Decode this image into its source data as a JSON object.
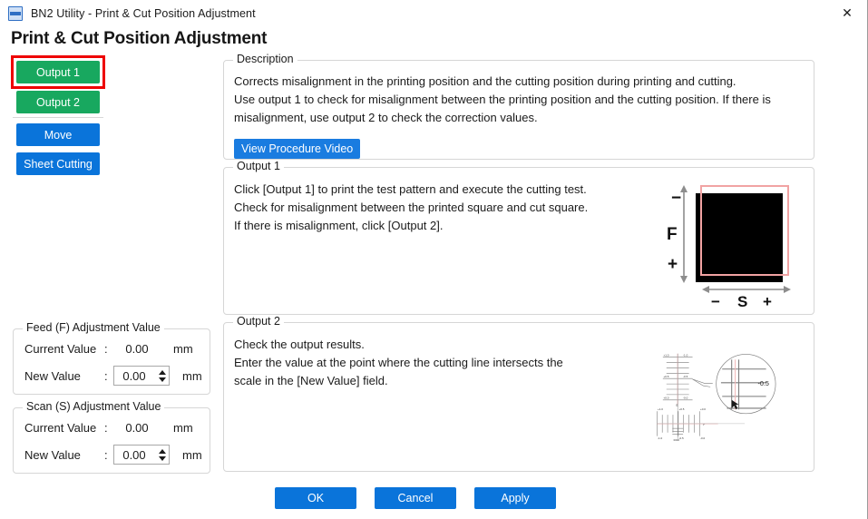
{
  "window": {
    "title": "BN2 Utility - Print & Cut Position Adjustment",
    "icon": "bn2-app-icon",
    "close_label": "✕"
  },
  "page_title": "Print & Cut Position Adjustment",
  "sidebar": {
    "buttons": [
      {
        "label": "Output 1",
        "color": "#18a85f",
        "focused": true
      },
      {
        "label": "Output 2",
        "color": "#18a85f",
        "focused": false
      },
      {
        "label": "Move",
        "color": "#0a74da",
        "focused": false
      },
      {
        "label": "Sheet Cutting",
        "color": "#0a74da",
        "focused": false
      }
    ]
  },
  "description": {
    "legend": "Description",
    "text": "Corrects misalignment in the printing position and the cutting position during printing and cutting.\nUse output 1 to check for misalignment between the printing position and the cutting position. If there is misalignment, use output 2 to check the correction values.",
    "video_button": "View Procedure Video"
  },
  "output1": {
    "legend": "Output 1",
    "text": "Click [Output 1] to print the test pattern and execute the cutting test.\nCheck for misalignment between the printed square and cut square.\nIf there is misalignment, click [Output 2].",
    "figure": {
      "feed_axis_label": "F",
      "feed_minus": "−",
      "feed_plus": "+",
      "scan_axis_label": "S",
      "scan_minus": "−",
      "scan_plus": "+",
      "printed_square_color": "#000000",
      "cut_square_color": "#f1a3a3"
    }
  },
  "output2": {
    "legend": "Output 2",
    "text": "Check the output results.\nEnter the value at the point where the cutting line intersects the\nscale in the [New Value] field.",
    "figure": {
      "magnifier_value": "-0.5",
      "scan_axis_label": "S",
      "feed_axis_label": "F",
      "vertical_scale_labels_left": [
        "+1.0",
        "+0.5",
        "+0.0"
      ],
      "vertical_scale_labels_right": [
        "-1.0",
        "-0.5",
        "-0.0"
      ],
      "horizontal_scale_labels_top": [
        "+1.0",
        "+0.5",
        "+0.0"
      ],
      "horizontal_scale_labels_bottom": [
        "-1.0",
        "-0.5",
        "-0.0"
      ],
      "cut_line_color": "#e8a0a0"
    }
  },
  "feed_adjust": {
    "legend": "Feed (F) Adjustment Value",
    "current_label": "Current Value",
    "current_value": "0.00",
    "new_label": "New Value",
    "new_value": "0.00",
    "colon": ":",
    "unit": "mm"
  },
  "scan_adjust": {
    "legend": "Scan (S) Adjustment Value",
    "current_label": "Current Value",
    "current_value": "0.00",
    "new_label": "New Value",
    "new_value": "0.00",
    "colon": ":",
    "unit": "mm"
  },
  "footer": {
    "ok": "OK",
    "cancel": "Cancel",
    "apply": "Apply"
  }
}
